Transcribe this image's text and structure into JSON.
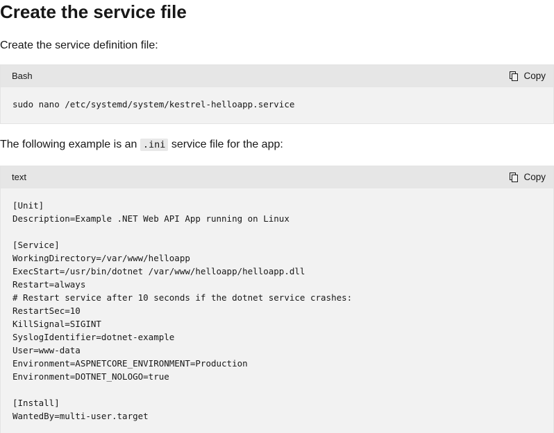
{
  "heading": "Create the service file",
  "intro_text": "Create the service definition file:",
  "block1": {
    "language": "Bash",
    "copy_label": "Copy",
    "code": "sudo nano /etc/systemd/system/kestrel-helloapp.service"
  },
  "example_text": {
    "before": "The following example is an ",
    "code": ".ini",
    "after": " service file for the app:"
  },
  "block2": {
    "language": "text",
    "copy_label": "Copy",
    "lines": [
      "[Unit]",
      "Description=Example .NET Web API App running on Linux",
      "",
      "[Service]",
      "WorkingDirectory=/var/www/helloapp",
      "ExecStart=/usr/bin/dotnet /var/www/helloapp/helloapp.dll",
      "Restart=always",
      "# Restart service after 10 seconds if the dotnet service crashes:",
      "RestartSec=10",
      "KillSignal=SIGINT",
      "SyslogIdentifier=dotnet-example",
      "User=www-data",
      "Environment=ASPNETCORE_ENVIRONMENT=Production",
      "Environment=DOTNET_NOLOGO=true",
      "",
      "[Install]",
      "WantedBy=multi-user.target"
    ]
  },
  "icons": {
    "copy": "copy-icon"
  }
}
